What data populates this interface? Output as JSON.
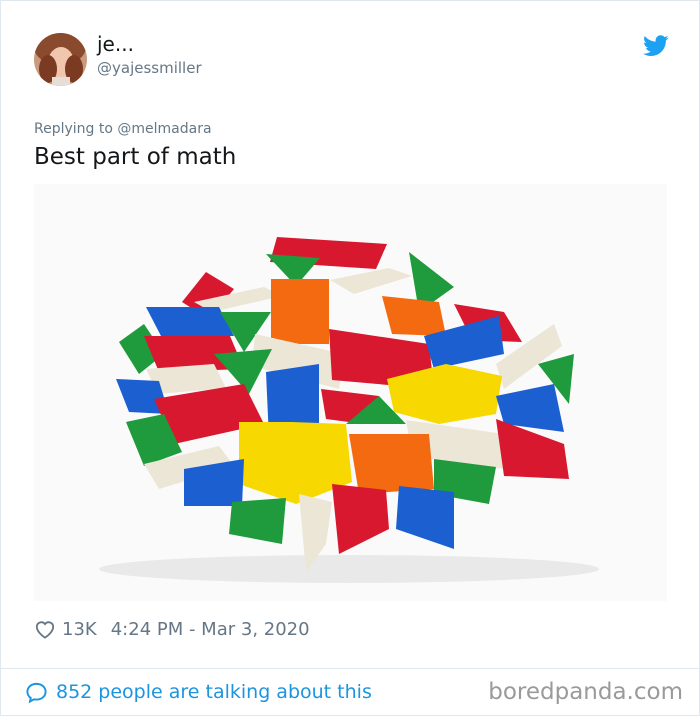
{
  "tweet": {
    "display_name": "je...",
    "handle": "@yajessmiller",
    "replying_to": "Replying to @melmadara",
    "text": "Best part of math",
    "likes": "13K",
    "timestamp": "4:24 PM - Mar 3, 2020",
    "talking": "852 people are talking about this",
    "media_subject": "pattern-blocks-pile"
  },
  "icons": {
    "brand": "twitter-bird-icon",
    "like": "heart-icon",
    "reply": "speech-bubble-icon"
  },
  "watermark": "boredpanda.com",
  "colors": {
    "twitter_blue": "#1da1f2",
    "link_blue": "#1b95e0",
    "secondary_text": "#657786",
    "block_red": "#d8182f",
    "block_green": "#1f9a3c",
    "block_blue": "#1b5fd1",
    "block_orange": "#f36a10",
    "block_yellow": "#f7d800",
    "block_tan": "#ece6d6"
  }
}
